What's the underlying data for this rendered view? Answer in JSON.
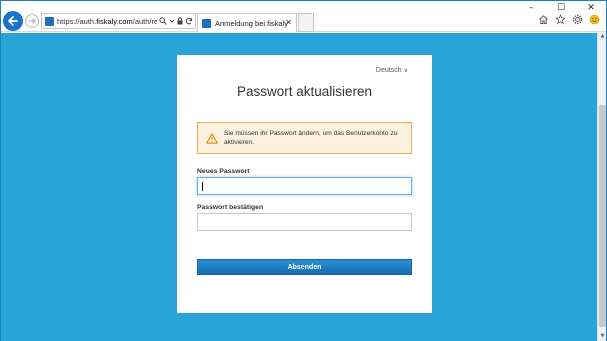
{
  "window": {
    "controls": {
      "minimize": "–",
      "maximize": "☐",
      "close": "✕"
    }
  },
  "browser": {
    "address": {
      "url_prefix": "https://auth.",
      "url_domain": "fiskaly.com",
      "url_rest": "/auth/realms/fis",
      "icons": {
        "search": "search-icon",
        "dropdown": "chevron-down-icon",
        "lock": "lock-icon",
        "refresh": "refresh-icon"
      }
    },
    "tab": {
      "label": "Anmeldung bei fiskaly",
      "close": "✕"
    },
    "right_icons": [
      "home-icon",
      "star-icon",
      "gear-icon",
      "smiley-icon"
    ]
  },
  "page": {
    "background": "#2aa3d9",
    "language": "Deutsch",
    "title": "Passwort aktualisieren",
    "alert": {
      "text": "Sie müssen ihr Passwort ändern, um das Benutzerkonto zu aktivieren.",
      "color": "#f0ad4e"
    },
    "fields": {
      "new_password_label": "Neues Passwort",
      "confirm_password_label": "Passwort bestätigen"
    },
    "submit_label": "Absenden",
    "submit_color": "#1a7bc1"
  }
}
